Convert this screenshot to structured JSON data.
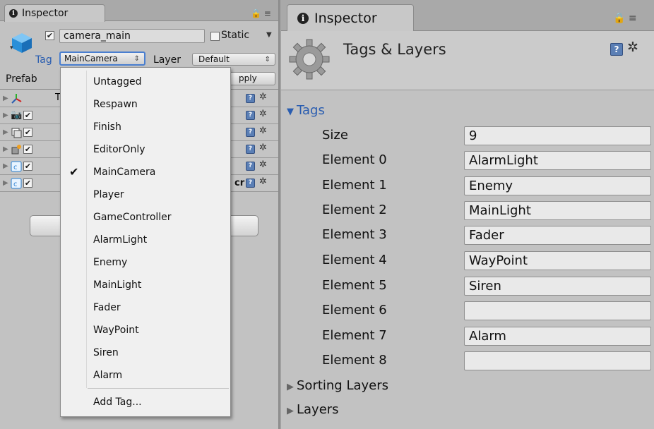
{
  "left": {
    "tab_title": "Inspector",
    "tab_tools": "🔒 ≡",
    "gameobject": {
      "name": "camera_main",
      "active": true,
      "static_label": "Static"
    },
    "tag": {
      "label": "Tag",
      "value": "MainCamera"
    },
    "layer": {
      "label": "Layer",
      "value": "Default"
    },
    "prefab": {
      "label": "Prefab",
      "apply_label": "Apply",
      "apply_visible": "pply"
    },
    "components": [
      {
        "icon": "transform-icon",
        "label": "T",
        "has_checkbox": false
      },
      {
        "icon": "camera-icon",
        "label": "",
        "has_checkbox": true
      },
      {
        "icon": "gui-layer-icon",
        "label": "",
        "has_checkbox": true
      },
      {
        "icon": "flare-layer-icon",
        "label": "",
        "has_checkbox": true
      },
      {
        "icon": "script-icon",
        "label": "",
        "has_checkbox": true
      },
      {
        "icon": "script-icon",
        "label": "cr",
        "has_checkbox": true
      }
    ]
  },
  "dropdown": {
    "items": [
      "Untagged",
      "Respawn",
      "Finish",
      "EditorOnly",
      "MainCamera",
      "Player",
      "GameController",
      "AlarmLight",
      "Enemy",
      "MainLight",
      "Fader",
      "WayPoint",
      "Siren",
      "Alarm"
    ],
    "checked": "MainCamera",
    "add_tag": "Add Tag..."
  },
  "right": {
    "tab_title": "Inspector",
    "tab_tools": "🔒 ≡",
    "header_title": "Tags & Layers",
    "tags_label": "Tags",
    "size_label": "Size",
    "size_value": "9",
    "elements": [
      {
        "label": "Element 0",
        "value": "AlarmLight"
      },
      {
        "label": "Element 1",
        "value": "Enemy"
      },
      {
        "label": "Element 2",
        "value": "MainLight"
      },
      {
        "label": "Element 3",
        "value": "Fader"
      },
      {
        "label": "Element 4",
        "value": "WayPoint"
      },
      {
        "label": "Element 5",
        "value": "Siren"
      },
      {
        "label": "Element 6",
        "value": ""
      },
      {
        "label": "Element 7",
        "value": "Alarm"
      },
      {
        "label": "Element 8",
        "value": ""
      }
    ],
    "sorting_layers_label": "Sorting Layers",
    "layers_label": "Layers"
  },
  "colors": {
    "accent_blue": "#2a5db0",
    "panel_bg": "#c2c2c2",
    "help_blue": "#5b7fb5"
  }
}
